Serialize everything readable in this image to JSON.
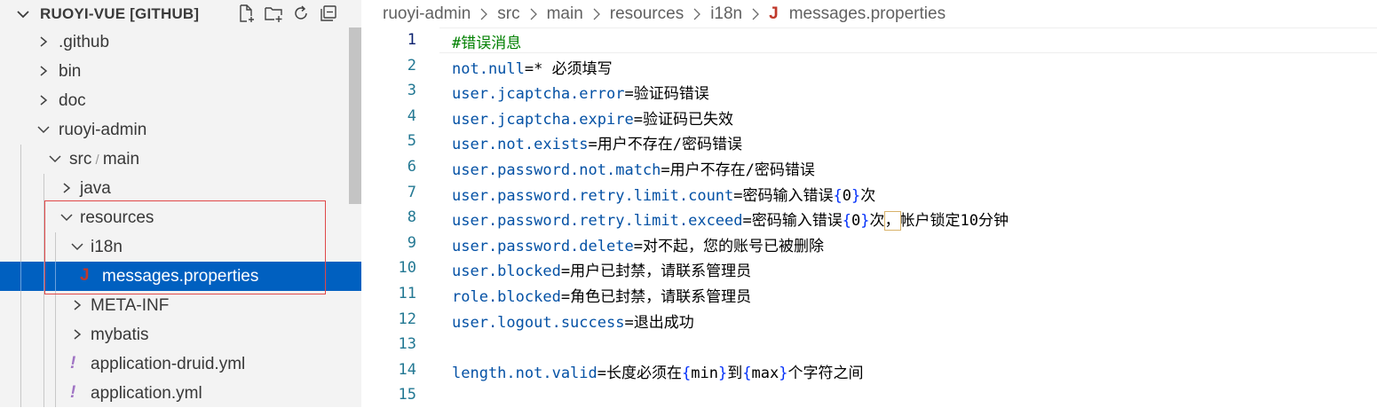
{
  "sidebar": {
    "title": "RUOYI-VUE [GITHUB]",
    "tools": [
      "new-file-icon",
      "new-folder-icon",
      "refresh-icon",
      "collapse-all-icon"
    ],
    "items": [
      {
        "label": "",
        "segments": [
          ".github"
        ],
        "type": "folder",
        "expanded": false,
        "depth": 0
      },
      {
        "label": "",
        "segments": [
          "bin"
        ],
        "type": "folder",
        "expanded": false,
        "depth": 0
      },
      {
        "label": "",
        "segments": [
          "doc"
        ],
        "type": "folder",
        "expanded": false,
        "depth": 0
      },
      {
        "label": "",
        "segments": [
          "ruoyi-admin"
        ],
        "type": "folder",
        "expanded": true,
        "depth": 0
      },
      {
        "label": "",
        "segments": [
          "src",
          "main"
        ],
        "type": "folder",
        "expanded": true,
        "depth": 1
      },
      {
        "label": "",
        "segments": [
          "java"
        ],
        "type": "folder",
        "expanded": false,
        "depth": 2
      },
      {
        "label": "",
        "segments": [
          "resources"
        ],
        "type": "folder",
        "expanded": true,
        "depth": 2
      },
      {
        "label": "",
        "segments": [
          "i18n"
        ],
        "type": "folder",
        "expanded": true,
        "depth": 3
      },
      {
        "label": "",
        "segments": [
          "messages.properties"
        ],
        "type": "file",
        "icon": "J",
        "icon_color": "#c0392b",
        "selected": true,
        "depth": 3
      },
      {
        "label": "",
        "segments": [
          "META-INF"
        ],
        "type": "folder",
        "expanded": false,
        "depth": 3
      },
      {
        "label": "",
        "segments": [
          "mybatis"
        ],
        "type": "folder",
        "expanded": false,
        "depth": 3
      },
      {
        "label": "",
        "segments": [
          "application-druid.yml"
        ],
        "type": "file",
        "icon": "!",
        "icon_color": "#a074c4",
        "depth": 3
      },
      {
        "label": "",
        "segments": [
          "application.yml"
        ],
        "type": "file",
        "icon": "!",
        "icon_color": "#a074c4",
        "depth": 3
      }
    ]
  },
  "breadcrumb": {
    "items": [
      "ruoyi-admin",
      "src",
      "main",
      "resources",
      "i18n"
    ],
    "file_icon": "J",
    "file": "messages.properties"
  },
  "editor": {
    "current_line": 1,
    "lines": [
      {
        "n": "1",
        "comment": "#错误消息"
      },
      {
        "n": "2",
        "key": "not.null",
        "value": "* 必须填写"
      },
      {
        "n": "3",
        "key": "user.jcaptcha.error",
        "value": "验证码错误"
      },
      {
        "n": "4",
        "key": "user.jcaptcha.expire",
        "value": "验证码已失效"
      },
      {
        "n": "5",
        "key": "user.not.exists",
        "value": "用户不存在/密码错误"
      },
      {
        "n": "6",
        "key": "user.password.not.match",
        "value": "用户不存在/密码错误"
      },
      {
        "n": "7",
        "key": "user.password.retry.limit.count",
        "value_parts": [
          "密码输入错误",
          "{",
          "0",
          "}",
          "次"
        ]
      },
      {
        "n": "8",
        "key": "user.password.retry.limit.exceed",
        "value_parts": [
          "密码输入错误",
          "{",
          "0",
          "}",
          "次",
          "，",
          "帐户锁定10分钟"
        ]
      },
      {
        "n": "9",
        "key": "user.password.delete",
        "value": "对不起，您的账号已被删除"
      },
      {
        "n": "10",
        "key": "user.blocked",
        "value": "用户已封禁，请联系管理员"
      },
      {
        "n": "11",
        "key": "role.blocked",
        "value": "角色已封禁，请联系管理员"
      },
      {
        "n": "12",
        "key": "user.logout.success",
        "value": "退出成功"
      },
      {
        "n": "13"
      },
      {
        "n": "14",
        "key": "length.not.valid",
        "value_parts": [
          "长度必须在",
          "{",
          "min",
          "}",
          "到",
          "{",
          "max",
          "}",
          "个字符之间"
        ]
      },
      {
        "n": "15"
      }
    ]
  },
  "colors": {
    "key": "#0451a5",
    "comment": "#008000",
    "brace": "#0431fa",
    "line_number": "#237893",
    "selection": "#0060c0",
    "highlight_box": "#e04848"
  }
}
